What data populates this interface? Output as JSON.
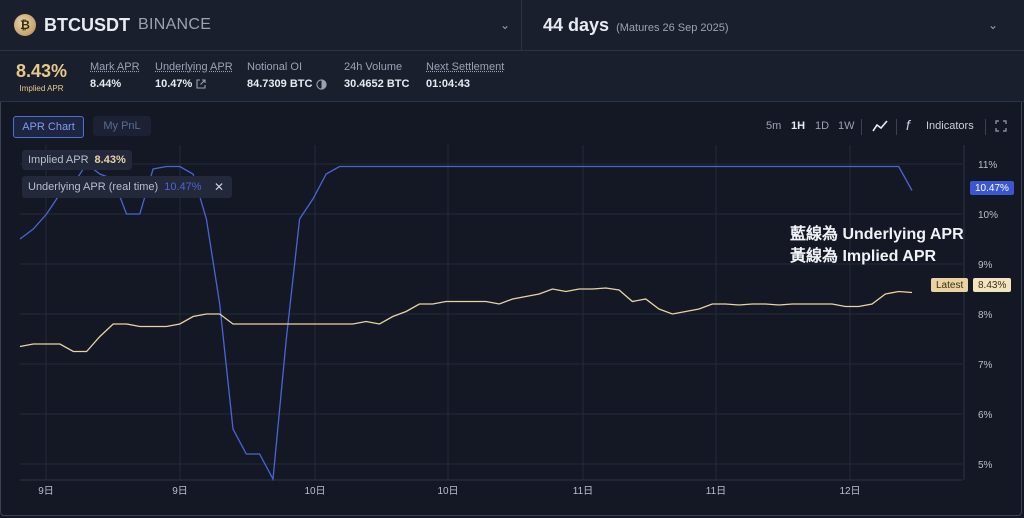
{
  "header": {
    "symbol": "BTCUSDT",
    "exchange": "BINANCE",
    "coin_icon": "bitcoin-icon",
    "days": "44 days",
    "maturity": "(Matures 26 Sep 2025)"
  },
  "stats": {
    "implied_value": "8.43%",
    "implied_label": "Implied APR",
    "items": [
      {
        "label": "Mark APR",
        "value": "8.44%"
      },
      {
        "label": "Underlying APR",
        "value": "10.47%"
      },
      {
        "label": "Notional OI",
        "value": "84.7309 BTC"
      },
      {
        "label": "24h Volume",
        "value": "30.4652 BTC"
      },
      {
        "label": "Next Settlement",
        "value": "01:04:43"
      }
    ]
  },
  "toolbar": {
    "tab_apr": "APR Chart",
    "tab_pnl": "My PnL",
    "timeframes": [
      "5m",
      "1H",
      "1D",
      "1W"
    ],
    "active_timeframe": "1H",
    "indicators": "Indicators"
  },
  "legend": {
    "implied_label": "Implied APR",
    "implied_value": "8.43%",
    "underlying_label": "Underlying APR (real time)",
    "underlying_value": "10.47%"
  },
  "annotation": {
    "line1": "藍線為 Underlying APR",
    "line2": "黃線為 Implied APR"
  },
  "price_tags": {
    "underlying": "10.47%",
    "latest_label": "Latest",
    "latest_value": "8.43%"
  },
  "colors": {
    "underlying": "#4a64d8",
    "implied": "#e9d3a3",
    "background": "#141824"
  },
  "chart_data": {
    "type": "line",
    "x_tick_labels": [
      "9日",
      "9日",
      "10日",
      "10日",
      "11日",
      "11日",
      "12日"
    ],
    "y_tick_labels": [
      "11%",
      "10%",
      "9%",
      "8%",
      "7%",
      "6%",
      "5%"
    ],
    "ylim": [
      4.6,
      11.3
    ],
    "grid": true,
    "series": [
      {
        "name": "Underlying APR",
        "color": "#4a64d8",
        "points": [
          [
            0,
            9.5
          ],
          [
            1,
            9.7
          ],
          [
            2,
            10.0
          ],
          [
            3,
            10.4
          ],
          [
            4,
            10.6
          ],
          [
            5,
            11.0
          ],
          [
            6,
            10.8
          ],
          [
            7,
            10.7
          ],
          [
            8,
            10.0
          ],
          [
            9,
            10.0
          ],
          [
            10,
            10.9
          ],
          [
            11,
            10.95
          ],
          [
            12,
            10.95
          ],
          [
            13,
            10.8
          ],
          [
            14,
            9.9
          ],
          [
            15,
            8.2
          ],
          [
            16,
            5.7
          ],
          [
            17,
            5.2
          ],
          [
            18,
            5.2
          ],
          [
            19,
            4.7
          ],
          [
            20,
            7.5
          ],
          [
            21,
            9.9
          ],
          [
            22,
            10.3
          ],
          [
            23,
            10.8
          ],
          [
            24,
            10.95
          ],
          [
            25,
            10.95
          ],
          [
            30,
            10.95
          ],
          [
            40,
            10.95
          ],
          [
            50,
            10.95
          ],
          [
            60,
            10.95
          ],
          [
            66,
            10.95
          ],
          [
            67,
            10.47
          ]
        ]
      },
      {
        "name": "Implied APR",
        "color": "#e9d3a3",
        "points": [
          [
            0,
            7.35
          ],
          [
            1,
            7.4
          ],
          [
            2,
            7.4
          ],
          [
            3,
            7.4
          ],
          [
            4,
            7.25
          ],
          [
            5,
            7.25
          ],
          [
            6,
            7.55
          ],
          [
            7,
            7.8
          ],
          [
            8,
            7.8
          ],
          [
            9,
            7.75
          ],
          [
            10,
            7.75
          ],
          [
            11,
            7.75
          ],
          [
            12,
            7.8
          ],
          [
            13,
            7.95
          ],
          [
            14,
            8.0
          ],
          [
            15,
            8.0
          ],
          [
            16,
            7.8
          ],
          [
            17,
            7.8
          ],
          [
            18,
            7.8
          ],
          [
            20,
            7.8
          ],
          [
            24,
            7.8
          ],
          [
            25,
            7.8
          ],
          [
            26,
            7.85
          ],
          [
            27,
            7.8
          ],
          [
            28,
            7.95
          ],
          [
            29,
            8.05
          ],
          [
            30,
            8.2
          ],
          [
            31,
            8.2
          ],
          [
            32,
            8.25
          ],
          [
            33,
            8.25
          ],
          [
            35,
            8.25
          ],
          [
            36,
            8.2
          ],
          [
            37,
            8.3
          ],
          [
            38,
            8.35
          ],
          [
            39,
            8.4
          ],
          [
            40,
            8.5
          ],
          [
            41,
            8.45
          ],
          [
            42,
            8.5
          ],
          [
            43,
            8.5
          ],
          [
            44,
            8.52
          ],
          [
            45,
            8.48
          ],
          [
            46,
            8.25
          ],
          [
            47,
            8.3
          ],
          [
            48,
            8.1
          ],
          [
            49,
            8.0
          ],
          [
            50,
            8.05
          ],
          [
            51,
            8.1
          ],
          [
            52,
            8.2
          ],
          [
            53,
            8.2
          ],
          [
            54,
            8.18
          ],
          [
            55,
            8.2
          ],
          [
            56,
            8.2
          ],
          [
            57,
            8.18
          ],
          [
            58,
            8.2
          ],
          [
            59,
            8.2
          ],
          [
            60,
            8.2
          ],
          [
            61,
            8.2
          ],
          [
            62,
            8.15
          ],
          [
            63,
            8.15
          ],
          [
            64,
            8.2
          ],
          [
            65,
            8.4
          ],
          [
            66,
            8.45
          ],
          [
            67,
            8.43
          ]
        ]
      }
    ]
  }
}
